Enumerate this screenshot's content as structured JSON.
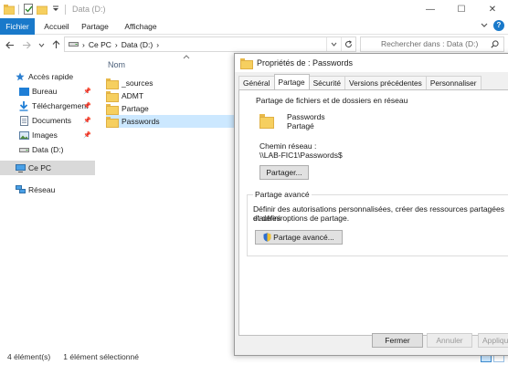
{
  "window": {
    "title": "Data (D:)",
    "controls": {
      "minimize": "—",
      "maximize": "☐",
      "close": "✕"
    }
  },
  "ribbon": {
    "tabs": [
      "Fichier",
      "Accueil",
      "Partage",
      "Affichage"
    ],
    "help": "?"
  },
  "address": {
    "crumbs": [
      "Ce PC",
      "Data (D:)"
    ],
    "search_placeholder": "Rechercher dans : Data (D:)"
  },
  "nav": {
    "items": [
      {
        "label": "Accès rapide",
        "icon": "star-icon"
      },
      {
        "label": "Bureau",
        "icon": "desktop-icon",
        "pinned": true
      },
      {
        "label": "Téléchargement",
        "icon": "download-icon",
        "pinned": true
      },
      {
        "label": "Documents",
        "icon": "documents-icon",
        "pinned": true
      },
      {
        "label": "Images",
        "icon": "images-icon",
        "pinned": true
      },
      {
        "label": "Data (D:)",
        "icon": "drive-icon"
      },
      {
        "label": "Ce PC",
        "icon": "pc-icon"
      },
      {
        "label": "Réseau",
        "icon": "network-icon"
      }
    ]
  },
  "files": {
    "column": "Nom",
    "items": [
      "_sources",
      "ADMT",
      "Partage",
      "Passwords"
    ],
    "selected": "Passwords"
  },
  "status": {
    "count": "4 élément(s)",
    "selection": "1 élément sélectionné"
  },
  "dialog": {
    "title": "Propriétés de : Passwords",
    "tabs": [
      "Général",
      "Partage",
      "Sécurité",
      "Versions précédentes",
      "Personnaliser"
    ],
    "active_tab": "Partage",
    "sharing": {
      "group_title": "Partage de fichiers et de dossiers en réseau",
      "folder_name": "Passwords",
      "state": "Partagé",
      "path_label": "Chemin réseau :",
      "path_value": "\\\\LAB-FIC1\\Passwords$",
      "share_button": "Partager..."
    },
    "advanced": {
      "group_title": "Partage avancé",
      "description_line1": "Définir des autorisations personnalisées, créer des ressources partagées et définir",
      "description_line2": "d'autres options de partage.",
      "button": "Partage avancé..."
    },
    "buttons": {
      "close": "Fermer",
      "cancel": "Annuler",
      "apply": "Appliquer"
    }
  }
}
